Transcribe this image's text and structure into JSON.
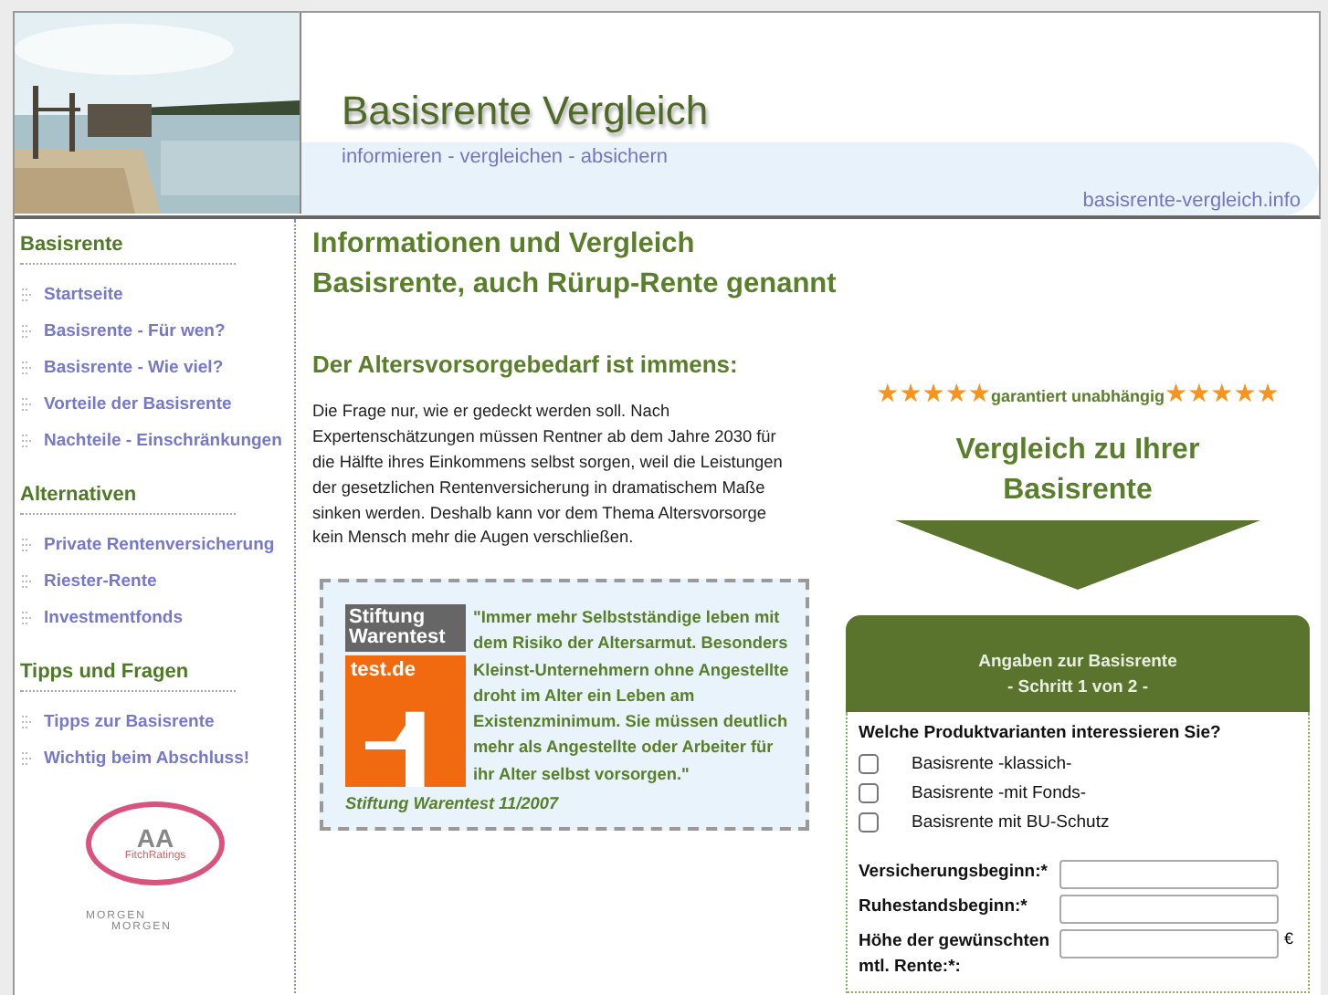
{
  "header": {
    "title": "Basisrente Vergleich",
    "tagline": "informieren - vergleichen - absichern",
    "url": "basisrente-vergleich.info"
  },
  "sidebar": {
    "sections": [
      {
        "title": "Basisrente",
        "items": [
          "Startseite",
          "Basisrente - Für wen?",
          "Basisrente - Wie viel?",
          "Vorteile der Basisrente",
          "Nachteile - Einschränkungen"
        ]
      },
      {
        "title": "Alternativen",
        "items": [
          "Private Rentenversicherung",
          "Riester-Rente",
          "Investmentfonds"
        ]
      },
      {
        "title": "Tipps und Fragen",
        "items": [
          "Tipps zur Basisrente",
          "Wichtig beim Abschluss!"
        ]
      }
    ],
    "rating_badge": {
      "grade": "AA",
      "agency": "FitchRatings"
    },
    "rating_logo": {
      "line_1": "MORGEN",
      "line_2": "MORGEN"
    }
  },
  "main": {
    "title": "Informationen und Vergleich Basisrente, auch Rürup-Rente genannt",
    "subtitle": "Der Altersvorsorgebedarf ist immens:",
    "paragraph": "Die Frage nur, wie er gedeckt werden soll. Nach Expertenschätzungen müssen Rentner ab dem Jahre 2030 für die Hälfte ihres Einkommens selbst sorgen, weil die Leistungen der gesetzlichen Rentenversicherung in dramatischem Maße sinken werden. Deshalb kann vor dem Thema Altersvorsorge kein Mensch mehr die Augen verschließen.",
    "quote": {
      "logo_top": "Stiftung Warentest",
      "logo_bottom": "test.de",
      "text": "\"Immer mehr Selbstständige leben mit dem Risiko der Altersarmut. Besonders Kleinst-Unternehmern ohne Angestellte droht im Alter ein Leben am Existenzminimum. Sie müssen deutlich mehr als Angestellte oder Arbeiter für ihr Alter selbst vorsorgen.\"",
      "source": "Stiftung Warentest 11/2007"
    }
  },
  "comparison": {
    "stars_left": {
      "stars": 5
    },
    "badge": "garantiert unabhängig",
    "stars_right": {
      "stars": 5
    },
    "title": "Vergleich zu Ihrer Basisrente",
    "form": {
      "title": "Angaben zur Basisrente",
      "step": "- Schritt 1 von 2 -",
      "question": "Welche Produktvarianten interessieren Sie?",
      "options": [
        {
          "label": "Basisrente -klassich-",
          "checked": false
        },
        {
          "label": "Basisrente -mit Fonds-",
          "checked": false
        },
        {
          "label": "Basisrente mit BU-Schutz",
          "checked": false
        }
      ],
      "fields": [
        {
          "label": "Versicherungsbeginn:*"
        },
        {
          "label": "Ruhestandsbeginn:*"
        },
        {
          "label": "Höhe der gewünschten mtl. Rente:*:",
          "unit": "€"
        }
      ]
    }
  }
}
